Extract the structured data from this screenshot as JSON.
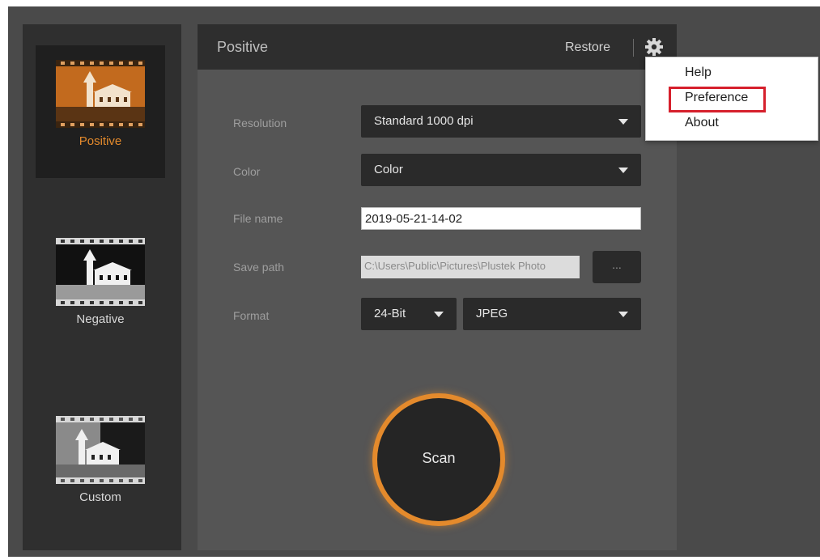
{
  "sidebar": {
    "modes": [
      {
        "label": "Positive",
        "icon": "positive-film-icon",
        "active": true
      },
      {
        "label": "Negative",
        "icon": "negative-film-icon",
        "active": false
      },
      {
        "label": "Custom",
        "icon": "custom-film-icon",
        "active": false
      }
    ]
  },
  "header": {
    "title": "Positive",
    "restore_label": "Restore",
    "settings_icon": "gear-icon"
  },
  "form": {
    "resolution": {
      "label": "Resolution",
      "value": "Standard 1000 dpi"
    },
    "color": {
      "label": "Color",
      "value": "Color"
    },
    "file_name": {
      "label": "File name",
      "value": "2019-05-21-14-02"
    },
    "save_path": {
      "label": "Save path",
      "value": "C:\\Users\\Public\\Pictures\\Plustek Photo",
      "browse_label": "..."
    },
    "format": {
      "label": "Format",
      "bit_depth": "24-Bit",
      "file_type": "JPEG"
    }
  },
  "scan_button": {
    "label": "Scan"
  },
  "settings_menu": {
    "items": [
      "Help",
      "Preference",
      "About"
    ],
    "highlighted": "Preference"
  },
  "colors": {
    "accent": "#e48a2c",
    "panel": "#555555",
    "header": "#2e2e2e",
    "highlight_box": "#d6202c"
  }
}
